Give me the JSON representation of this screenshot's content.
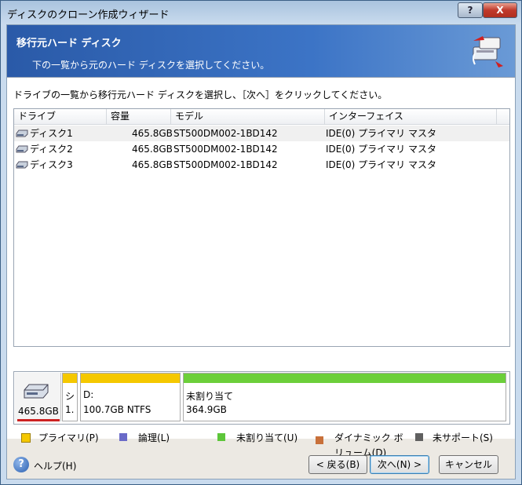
{
  "window": {
    "title": "ディスクのクローン作成ウィザード",
    "help_btn": "?",
    "close_btn": "X"
  },
  "banner": {
    "title": "移行元ハード ディスク",
    "subtitle": "下の一覧から元のハード ディスクを選択してください。",
    "icon": "disk-clone-icon"
  },
  "instruction": "ドライブの一覧から移行元ハード ディスクを選択し、［次へ］をクリックしてください。",
  "table": {
    "columns": [
      "ドライブ",
      "容量",
      "モデル",
      "インターフェイス"
    ],
    "rows": [
      {
        "drive": "ディスク1",
        "capacity": "465.8GB",
        "model": "ST500DM002-1BD142",
        "interface": "IDE(0) プライマリ マスタ"
      },
      {
        "drive": "ディスク2",
        "capacity": "465.8GB",
        "model": "ST500DM002-1BD142",
        "interface": "IDE(0) プライマリ マスタ"
      },
      {
        "drive": "ディスク3",
        "capacity": "465.8GB",
        "model": "ST500DM002-1BD142",
        "interface": "IDE(0) プライマリ マスタ"
      }
    ]
  },
  "disk_map": {
    "disk_size": "465.8GB",
    "partitions": [
      {
        "line1": "シ",
        "line2": "1.",
        "color": "#f5c800"
      },
      {
        "line1": "D:",
        "line2": "100.7GB  NTFS",
        "color": "#f5c800"
      },
      {
        "line1": "未割り当て",
        "line2": "364.9GB",
        "color": "#6ccf3a"
      }
    ]
  },
  "legend": [
    {
      "label": "プライマリ(P)",
      "color": "#f5c800"
    },
    {
      "label": "論理(L)",
      "color": "#6a6ac8"
    },
    {
      "label": "未割り当て(U)",
      "color": "#5dc63a"
    },
    {
      "label": "ダイナミック ボ",
      "label2": "リューム(D)",
      "color": "#c8703a"
    },
    {
      "label": "未サポート(S)",
      "color": "#606060"
    }
  ],
  "footer": {
    "help": "ヘルプ(H)",
    "back": "< 戻る(B)",
    "next": "次へ(N) >",
    "cancel": "キャンセル"
  },
  "colors": {
    "banner": "#2a5aa8",
    "accent_red": "#cc2222"
  }
}
